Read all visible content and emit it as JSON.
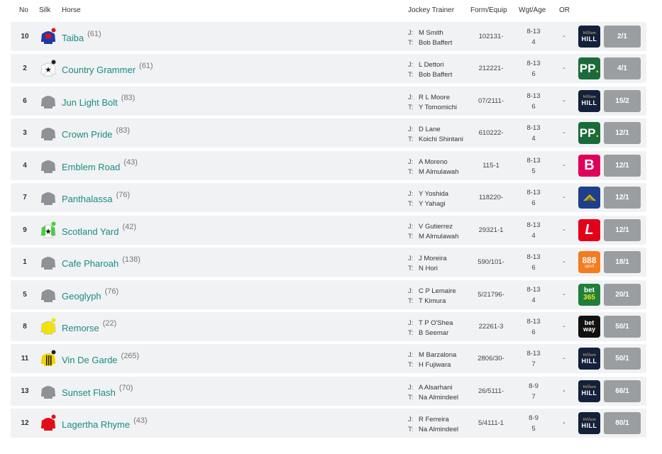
{
  "headers": {
    "no": "No",
    "silk": "Silk",
    "horse": "Horse",
    "jockey_trainer": "Jockey Trainer",
    "form": "Form/Equip",
    "wgt": "Wgt/Age",
    "or": "OR"
  },
  "labels": {
    "jockey": "J:",
    "trainer": "T:"
  },
  "runners": [
    {
      "no": "10",
      "name": "Taiba",
      "rating": "(61)",
      "jockey": "M Smith",
      "trainer": "Bob Baffert",
      "form": "102131-",
      "wgt": "8-13",
      "age": "4",
      "or": "-",
      "bookmaker": "William Hill",
      "odds": "2/1",
      "silk": "blue-red-silk",
      "bookicon": "williamhill-icon"
    },
    {
      "no": "2",
      "name": "Country Grammer",
      "rating": "(61)",
      "jockey": "L Dettori",
      "trainer": "Bob Baffert",
      "form": "212221-",
      "wgt": "8-13",
      "age": "6",
      "or": "-",
      "bookmaker": "Paddy Power",
      "odds": "4/1",
      "silk": "white-black-silk",
      "bookicon": "paddypower-icon"
    },
    {
      "no": "6",
      "name": "Jun Light Bolt",
      "rating": "(83)",
      "jockey": "R L Moore",
      "trainer": "Y Tomomichi",
      "form": "07/2111-",
      "wgt": "8-13",
      "age": "6",
      "or": "-",
      "bookmaker": "William Hill",
      "odds": "15/2",
      "silk": "grey-silk",
      "bookicon": "williamhill-icon"
    },
    {
      "no": "3",
      "name": "Crown Pride",
      "rating": "(83)",
      "jockey": "D Lane",
      "trainer": "Koichi Shintani",
      "form": "610222-",
      "wgt": "8-13",
      "age": "4",
      "or": "-",
      "bookmaker": "Paddy Power",
      "odds": "12/1",
      "silk": "grey-silk",
      "bookicon": "paddypower-icon"
    },
    {
      "no": "4",
      "name": "Emblem Road",
      "rating": "(43)",
      "jockey": "A Moreno",
      "trainer": "M Almulawah",
      "form": "115-1",
      "wgt": "8-13",
      "age": "5",
      "or": "-",
      "bookmaker": "BoyleSports",
      "odds": "12/1",
      "silk": "grey-silk",
      "bookicon": "boylesports-icon"
    },
    {
      "no": "7",
      "name": "Panthalassa",
      "rating": "(76)",
      "jockey": "Y Yoshida",
      "trainer": "Y Yahagi",
      "form": "118220-",
      "wgt": "8-13",
      "age": "6",
      "or": "-",
      "bookmaker": "Betfair",
      "odds": "12/1",
      "silk": "grey-silk",
      "bookicon": "betfair-icon"
    },
    {
      "no": "9",
      "name": "Scotland Yard",
      "rating": "(42)",
      "jockey": "V Gutierrez",
      "trainer": "M Almulawah",
      "form": "29321-1",
      "wgt": "8-13",
      "age": "4",
      "or": "-",
      "bookmaker": "Ladbrokes",
      "odds": "12/1",
      "silk": "white-green-silk",
      "bookicon": "ladbrokes-icon"
    },
    {
      "no": "1",
      "name": "Cafe Pharoah",
      "rating": "(138)",
      "jockey": "J Moreira",
      "trainer": "N Hori",
      "form": "590/101-",
      "wgt": "8-13",
      "age": "6",
      "or": "-",
      "bookmaker": "888 sport",
      "odds": "18/1",
      "silk": "grey-silk",
      "bookicon": "888sport-icon"
    },
    {
      "no": "5",
      "name": "Geoglyph",
      "rating": "(76)",
      "jockey": "C P Lemaire",
      "trainer": "T Kimura",
      "form": "5/21796-",
      "wgt": "8-13",
      "age": "4",
      "or": "-",
      "bookmaker": "bet365",
      "odds": "20/1",
      "silk": "grey-silk",
      "bookicon": "bet365-icon"
    },
    {
      "no": "8",
      "name": "Remorse",
      "rating": "(22)",
      "jockey": "T P O'Shea",
      "trainer": "B Seemar",
      "form": "22261-3",
      "wgt": "8-13",
      "age": "6",
      "or": "-",
      "bookmaker": "betway",
      "odds": "50/1",
      "silk": "yellow-silk",
      "bookicon": "betway-icon"
    },
    {
      "no": "11",
      "name": "Vin De Garde",
      "rating": "(265)",
      "jockey": "M Barzalona",
      "trainer": "H Fujiwara",
      "form": "2806/30-",
      "wgt": "8-13",
      "age": "7",
      "or": "-",
      "bookmaker": "William Hill",
      "odds": "50/1",
      "silk": "yellow-black-stripe-silk",
      "bookicon": "williamhill-icon"
    },
    {
      "no": "13",
      "name": "Sunset Flash",
      "rating": "(70)",
      "jockey": "A Alsarhani",
      "trainer": "Na Almindeel",
      "form": "26/5111-",
      "wgt": "8-9",
      "age": "7",
      "or": "-",
      "bookmaker": "William Hill",
      "odds": "66/1",
      "silk": "grey-silk",
      "bookicon": "williamhill-icon"
    },
    {
      "no": "12",
      "name": "Lagertha Rhyme",
      "rating": "(43)",
      "jockey": "R Ferreira",
      "trainer": "Na Almindeel",
      "form": "5/4111-1",
      "wgt": "8-9",
      "age": "5",
      "or": "-",
      "bookmaker": "William Hill",
      "odds": "80/1",
      "silk": "red-silk",
      "bookicon": "williamhill-icon"
    }
  ],
  "book_text": {
    "williamhill": {
      "top": "William",
      "bottom": "HILL"
    },
    "paddypower": "PP",
    "boylesports": "B",
    "ladbrokes": "L",
    "888sport": {
      "top": "888",
      "bottom": "sport"
    },
    "bet365": {
      "top": "bet",
      "bottom": "365"
    },
    "betway": {
      "top": "bet",
      "bottom": "way"
    }
  },
  "colors": {
    "row_bg": "#f1f2f3",
    "horse_name": "#1a8a87",
    "odds_bg": "#9b9ea1",
    "williamhill": "#13213a",
    "paddypower": "#1b6b3a",
    "boylesports": "#e0005a",
    "betfair": "#1e3f8c",
    "ladbrokes": "#e2001a",
    "888sport": "#f47b20",
    "bet365": "#1f7f3a",
    "betway": "#111111"
  }
}
